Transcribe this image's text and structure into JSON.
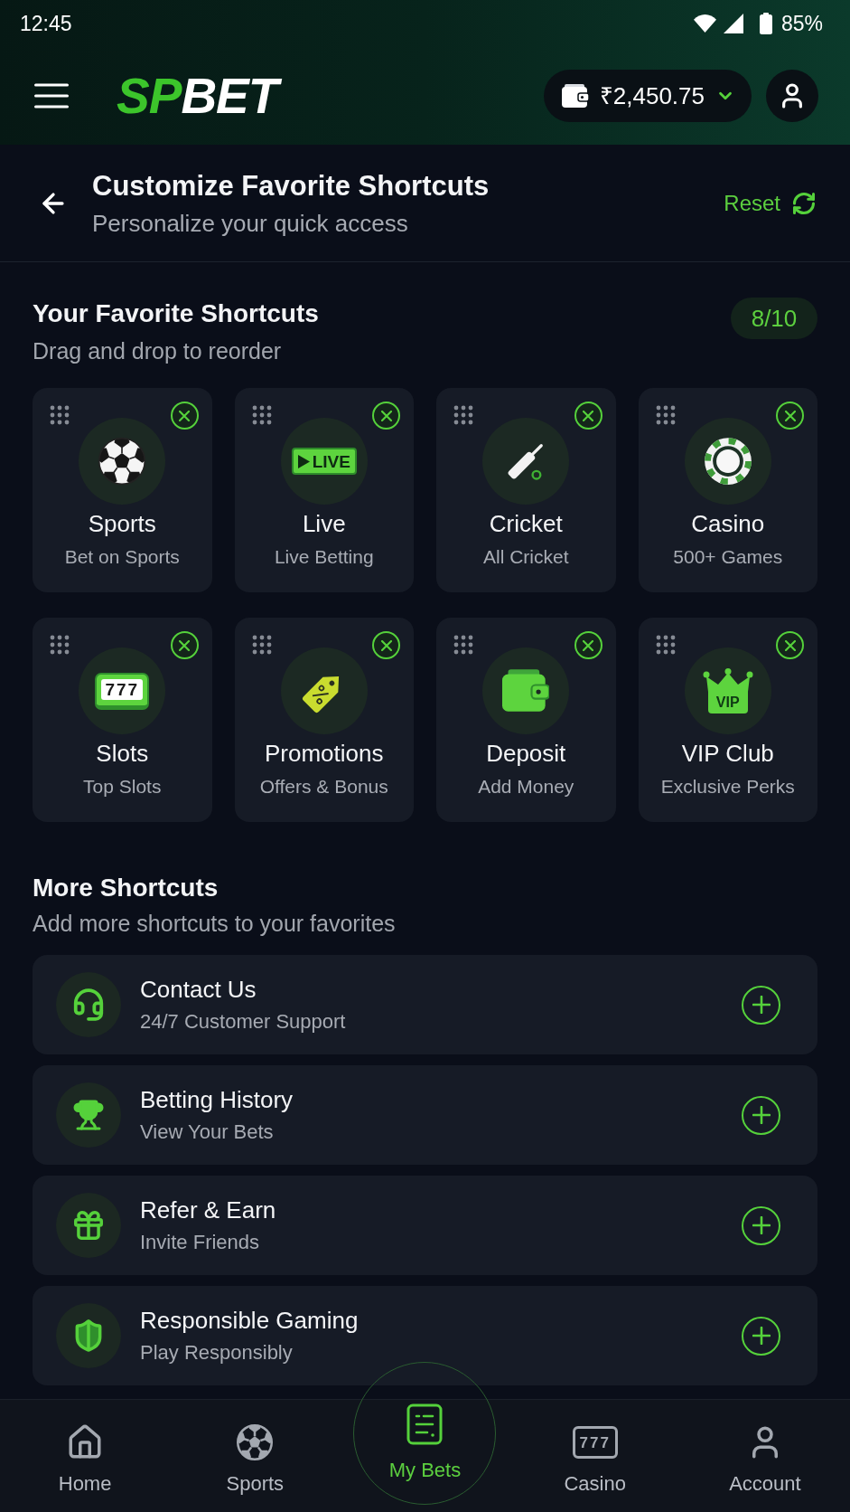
{
  "status_bar": {
    "time": "12:45",
    "battery": "85%"
  },
  "header": {
    "logo_accent": "SP",
    "logo_rest": "BET",
    "balance": "₹2,450.75"
  },
  "page_header": {
    "title": "Customize Favorite Shortcuts",
    "subtitle": "Personalize your quick access",
    "action": "Reset"
  },
  "favorites": {
    "title": "Your Favorite Shortcuts",
    "subtitle": "Drag and drop to reorder",
    "count": "8/10",
    "items": [
      {
        "kind": "ball",
        "title": "Sports",
        "subtitle": "Bet on Sports"
      },
      {
        "kind": "live",
        "title": "Live",
        "subtitle": "Live Betting",
        "icon_text": "LIVE"
      },
      {
        "kind": "bat",
        "title": "Cricket",
        "subtitle": "All Cricket"
      },
      {
        "kind": "chip",
        "title": "Casino",
        "subtitle": "500+ Games"
      },
      {
        "kind": "slots",
        "title": "Slots",
        "subtitle": "Top Slots",
        "icon_text": "777"
      },
      {
        "kind": "tag",
        "title": "Promotions",
        "subtitle": "Offers & Bonus"
      },
      {
        "kind": "wallet",
        "title": "Deposit",
        "subtitle": "Add Money"
      },
      {
        "kind": "crown",
        "title": "VIP Club",
        "subtitle": "Exclusive Perks",
        "icon_text": "VIP"
      }
    ]
  },
  "more": {
    "title": "More Shortcuts",
    "subtitle": "Add more shortcuts to your favorites",
    "items": [
      {
        "kind": "headset",
        "title": "Contact Us",
        "subtitle": "24/7 Customer Support"
      },
      {
        "kind": "trophy",
        "title": "Betting History",
        "subtitle": "View Your Bets"
      },
      {
        "kind": "gift",
        "title": "Refer & Earn",
        "subtitle": "Invite Friends"
      },
      {
        "kind": "shield",
        "title": "Responsible Gaming",
        "subtitle": "Play Responsibly"
      }
    ]
  },
  "bottom_nav": [
    {
      "kind": "home",
      "label": "Home",
      "selected": false
    },
    {
      "kind": "ball",
      "label": "Sports",
      "selected": false
    },
    {
      "kind": "bets",
      "label": "My Bets",
      "selected": true
    },
    {
      "kind": "slots",
      "label": "Casino",
      "selected": false,
      "icon_text": "777"
    },
    {
      "kind": "user",
      "label": "Account",
      "selected": false
    }
  ]
}
